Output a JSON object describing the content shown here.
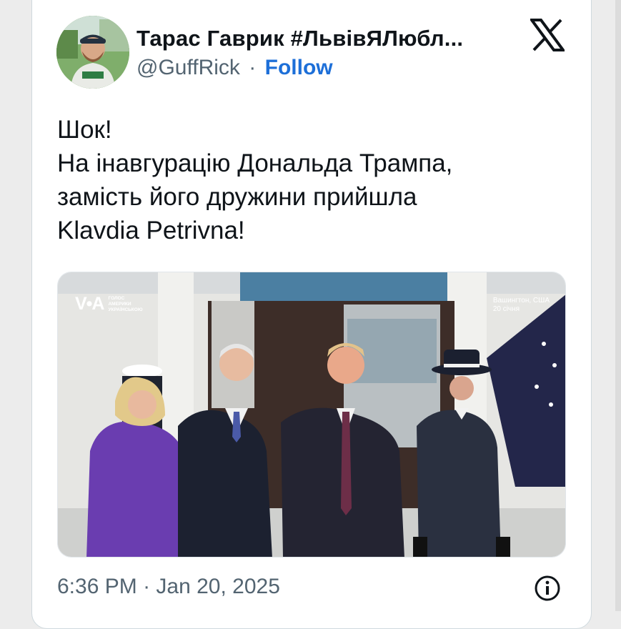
{
  "tweet": {
    "display_name": "Тарас Гаврик #ЛьвівЯЛюбл...",
    "handle": "@GuffRick",
    "separator": "·",
    "follow_label": "Follow",
    "text_lines": [
      "Шок!",
      "На інавгурацію Дональда Трампа,",
      "замість його дружини прийшла",
      "Klavdia Petrivna!"
    ],
    "time": "6:36 PM",
    "date": "Jan 20, 2025"
  },
  "photo": {
    "watermark_logo": "V•A",
    "watermark_lines": [
      "ГОЛОС",
      "АМЕРИКИ",
      "УКРАЇНСЬКОЮ"
    ],
    "location": "Вашингтон, США",
    "date_caption": "20 січня"
  },
  "icons": {
    "brand": "x-logo-icon",
    "info": "info-icon"
  },
  "colors": {
    "text": "#0f1419",
    "muted": "#536471",
    "link": "#1d6fd8"
  }
}
